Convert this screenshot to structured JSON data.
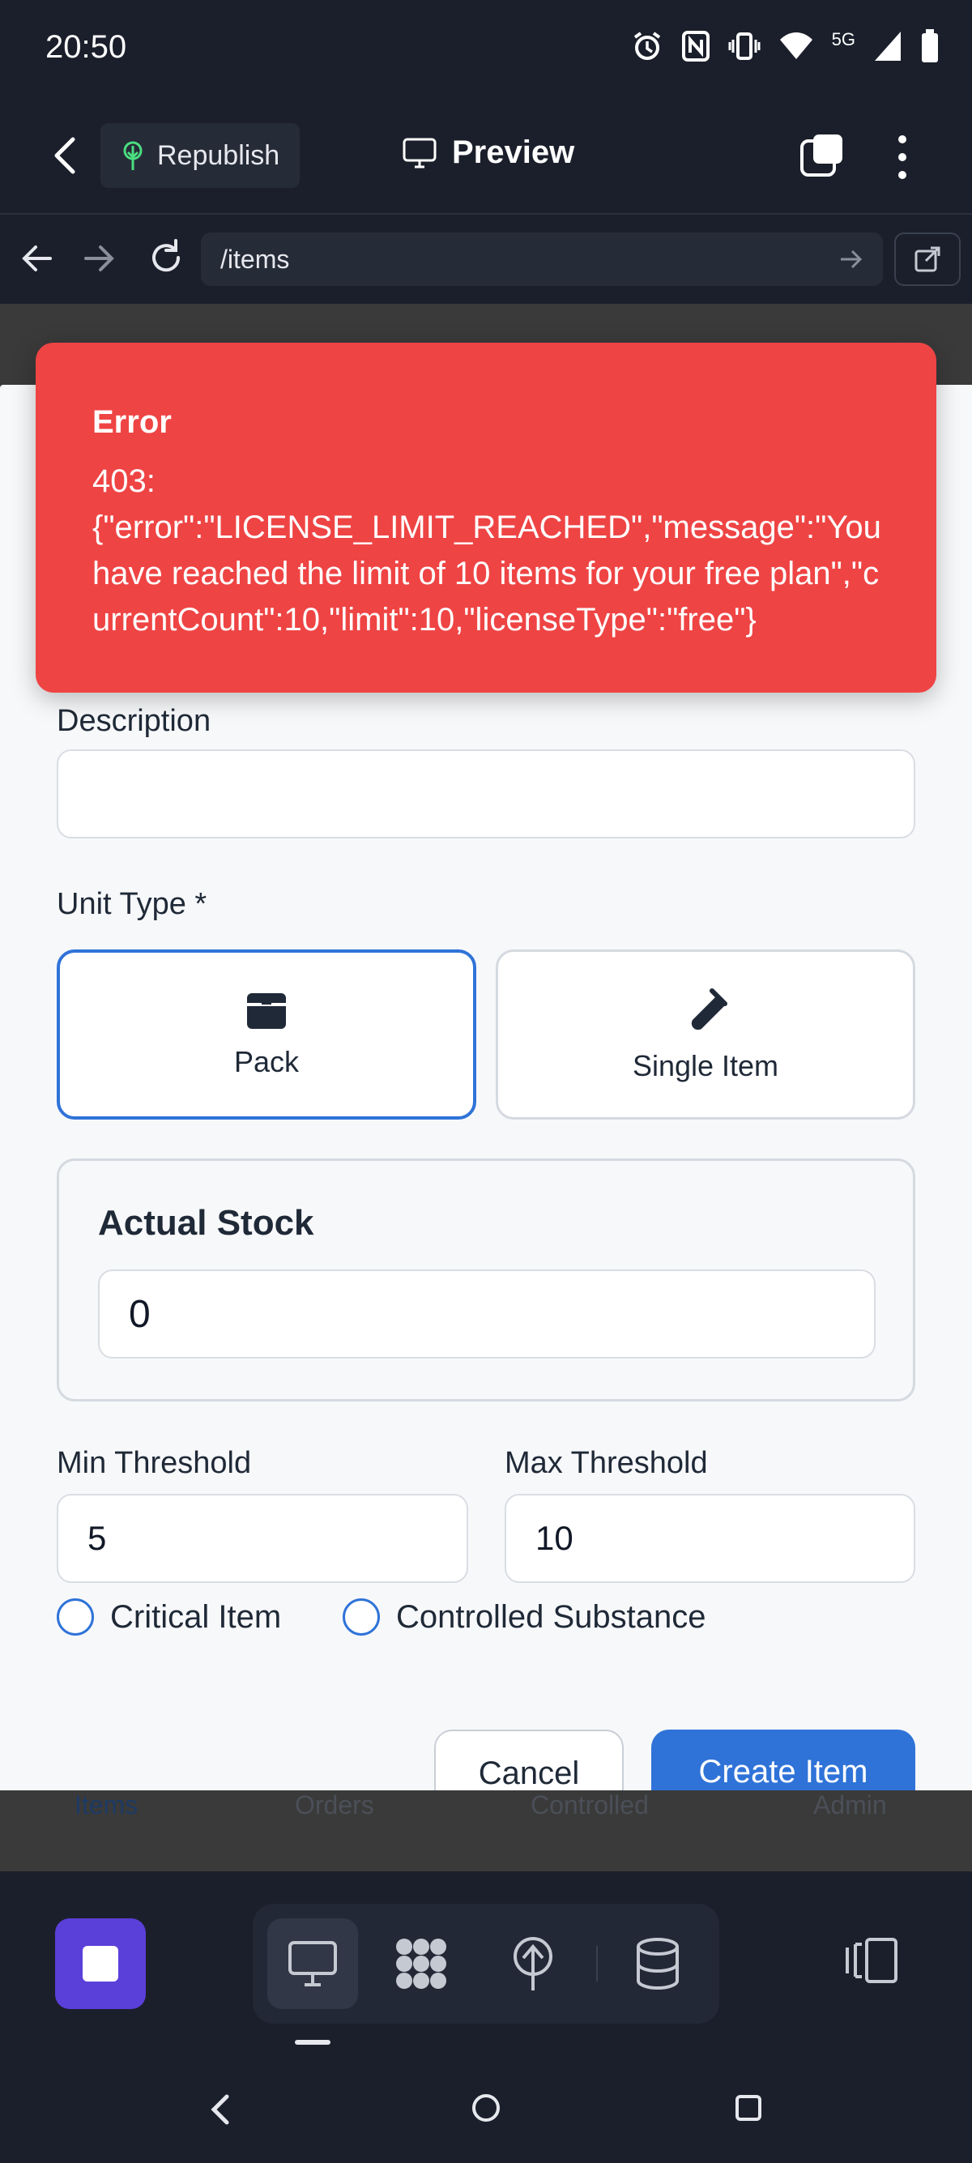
{
  "status_bar": {
    "time": "20:50",
    "network": "5G"
  },
  "header": {
    "republish_label": "Republish",
    "preview_label": "Preview"
  },
  "url_bar": {
    "path": "/items"
  },
  "toast": {
    "title": "Error",
    "message": "403:\n{\"error\":\"LICENSE_LIMIT_REACHED\",\"message\":\"You have reached the limit of 10 items for your free plan\",\"currentCount\":10,\"limit\":10,\"licenseType\":\"free\"}"
  },
  "form": {
    "description_label": "Description",
    "description_value": "",
    "unit_type_label": "Unit Type *",
    "unit_types": [
      {
        "label": "Pack",
        "icon": "box-icon",
        "selected": true
      },
      {
        "label": "Single Item",
        "icon": "test-tube-icon",
        "selected": false
      }
    ],
    "actual_stock_label": "Actual Stock",
    "actual_stock_value": "0",
    "min_threshold_label": "Min Threshold",
    "min_threshold_value": "5",
    "max_threshold_label": "Max Threshold",
    "max_threshold_value": "10",
    "critical_item_label": "Critical Item",
    "controlled_substance_label": "Controlled Substance",
    "cancel_label": "Cancel",
    "create_label": "Create Item"
  },
  "page_nav": {
    "items": [
      "Items",
      "Orders",
      "Controlled",
      "Admin"
    ],
    "active": "Items"
  },
  "colors": {
    "primary": "#2f73d8",
    "error": "#ef4444",
    "app_accent": "#5b3fd9",
    "chrome_bg": "#1b1f2b"
  }
}
